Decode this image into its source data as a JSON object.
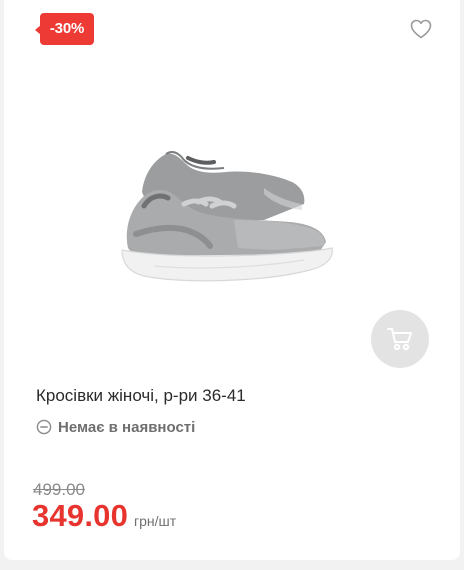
{
  "product": {
    "discount": "-30%",
    "title": "Кросівки жіночі, р-ри 36-41",
    "availability": "Немає в наявності",
    "old_price": "499.00",
    "price": "349.00",
    "unit": "грн/шт"
  },
  "icons": {
    "wishlist": "heart-outline-icon",
    "cart": "cart-icon",
    "stock": "minus-circle-icon"
  },
  "colors": {
    "accent": "#ee3a34",
    "price": "#e8342f",
    "cart_button_bg": "#e3e3e3",
    "muted_text": "#6f6f6f"
  }
}
